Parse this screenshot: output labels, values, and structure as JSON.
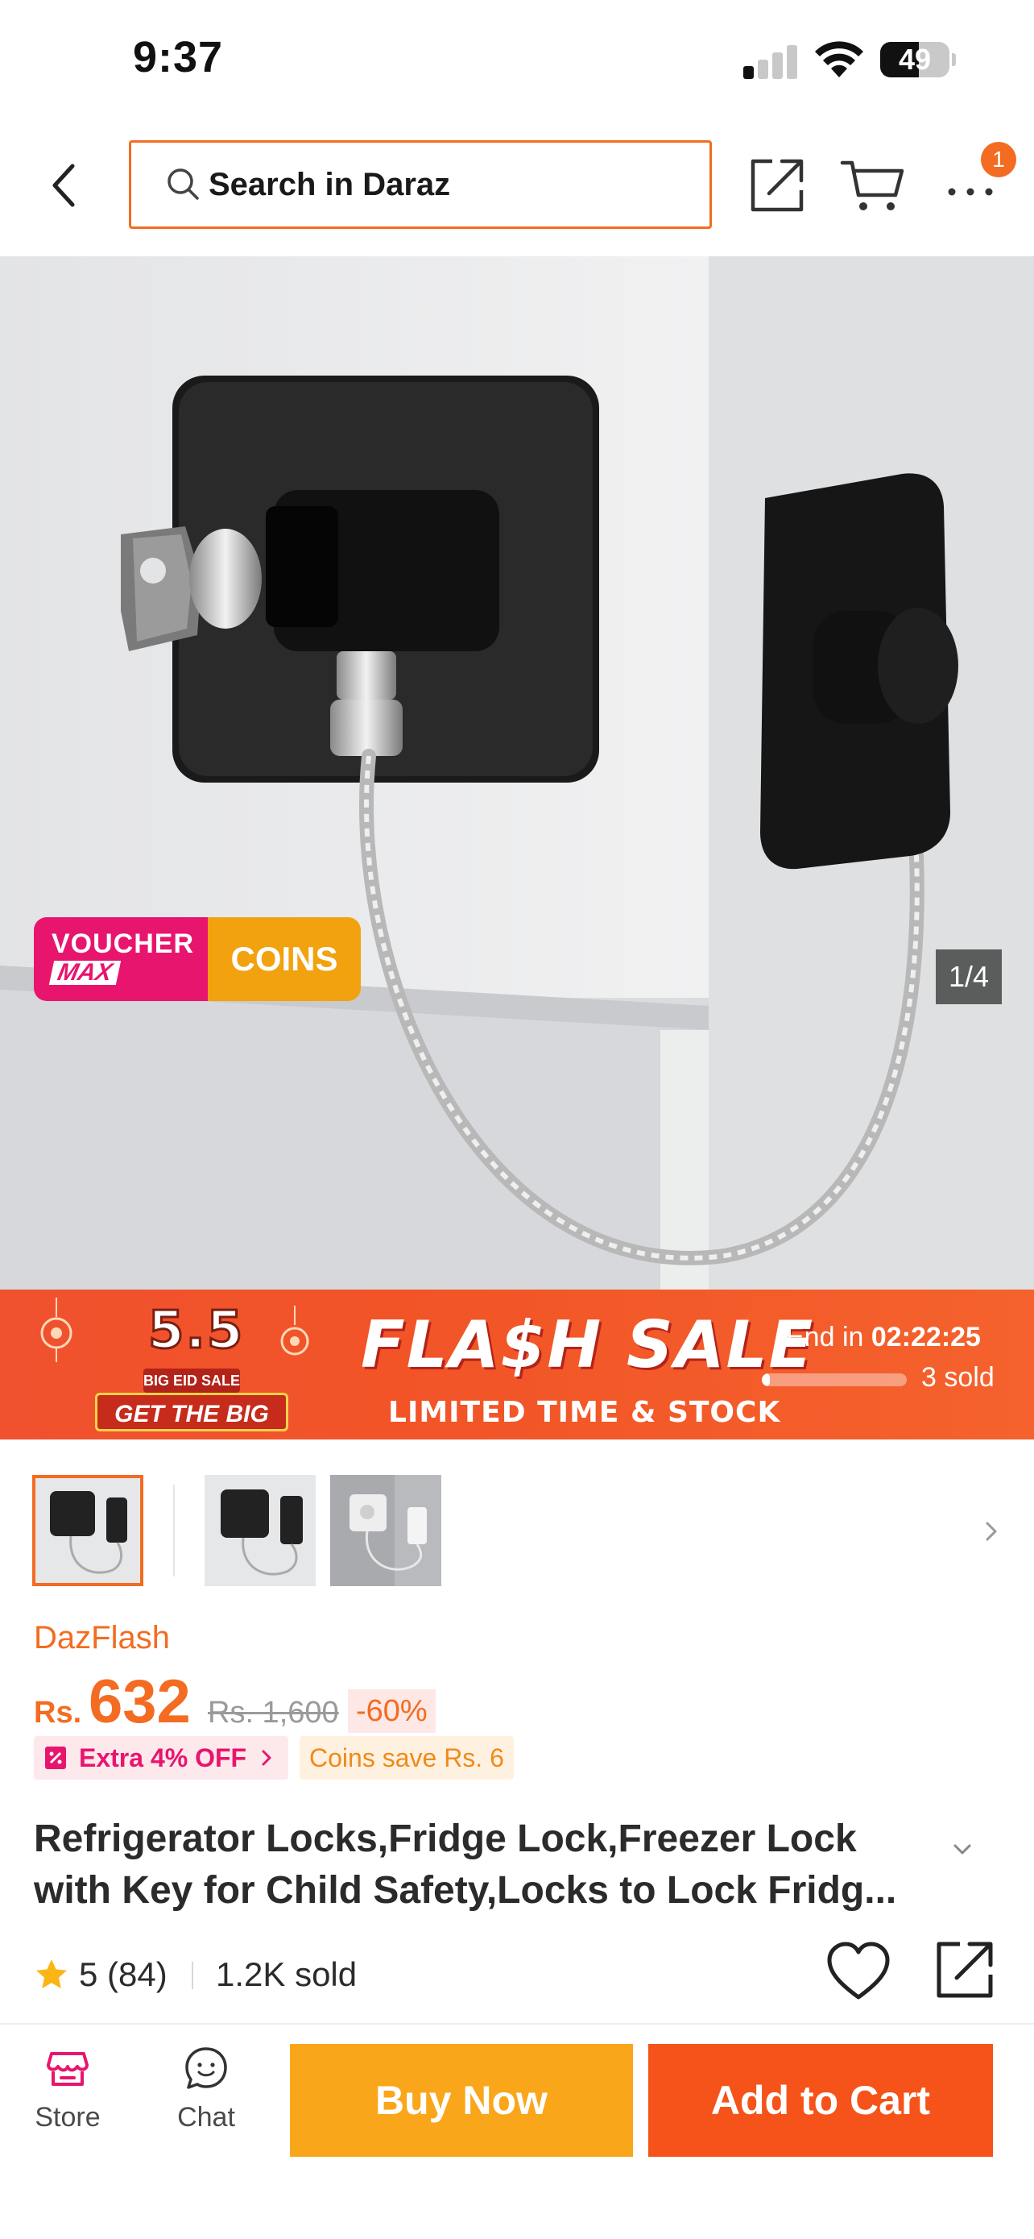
{
  "status_bar": {
    "time": "9:37",
    "battery_level": "49",
    "signal_bars_active": 1,
    "signal_bars_total": 4
  },
  "header": {
    "search_placeholder": "Search in Daraz",
    "cart_badge": "1",
    "icons": [
      "back-icon",
      "search-icon",
      "share-icon",
      "cart-icon",
      "more-icon"
    ]
  },
  "product_image": {
    "voucher_badge": {
      "line1": "VOUCHER",
      "line2": "MAX",
      "coins": "COINS"
    },
    "counter": "1/4"
  },
  "flash_sale": {
    "event_number": "5.5",
    "event_name": "BIG EID SALE",
    "event_slogan": "GET THE BIG ONE!",
    "title": "FLA$H SALE",
    "subtitle": "LIMITED TIME & STOCK",
    "end_label": "End in",
    "countdown": "02:22:25",
    "sold_text": "3 sold",
    "sold_progress": 0.05
  },
  "thumbnails": {
    "count": 3,
    "active_index": 0
  },
  "product": {
    "store": "DazFlash",
    "currency": "Rs.",
    "price": "632",
    "original_price": "Rs. 1,600",
    "discount": "-60%",
    "extra_off": "Extra 4% OFF",
    "coins_save": "Coins save Rs. 6",
    "title_line1": "Refrigerator Locks,Fridge Lock,Freezer Lock",
    "title_line2": "with Key for Child Safety,Locks to Lock Fridg...",
    "rating": "5 (84)",
    "sold": "1.2K sold"
  },
  "bottom_bar": {
    "store_label": "Store",
    "chat_label": "Chat",
    "buy_now": "Buy Now",
    "add_to_cart": "Add to Cart"
  },
  "colors": {
    "accent": "#f36c21",
    "voucher_pink": "#e8156e",
    "coins_orange": "#f2a20f",
    "buy_now": "#faa61a",
    "add_to_cart": "#f5531a"
  }
}
